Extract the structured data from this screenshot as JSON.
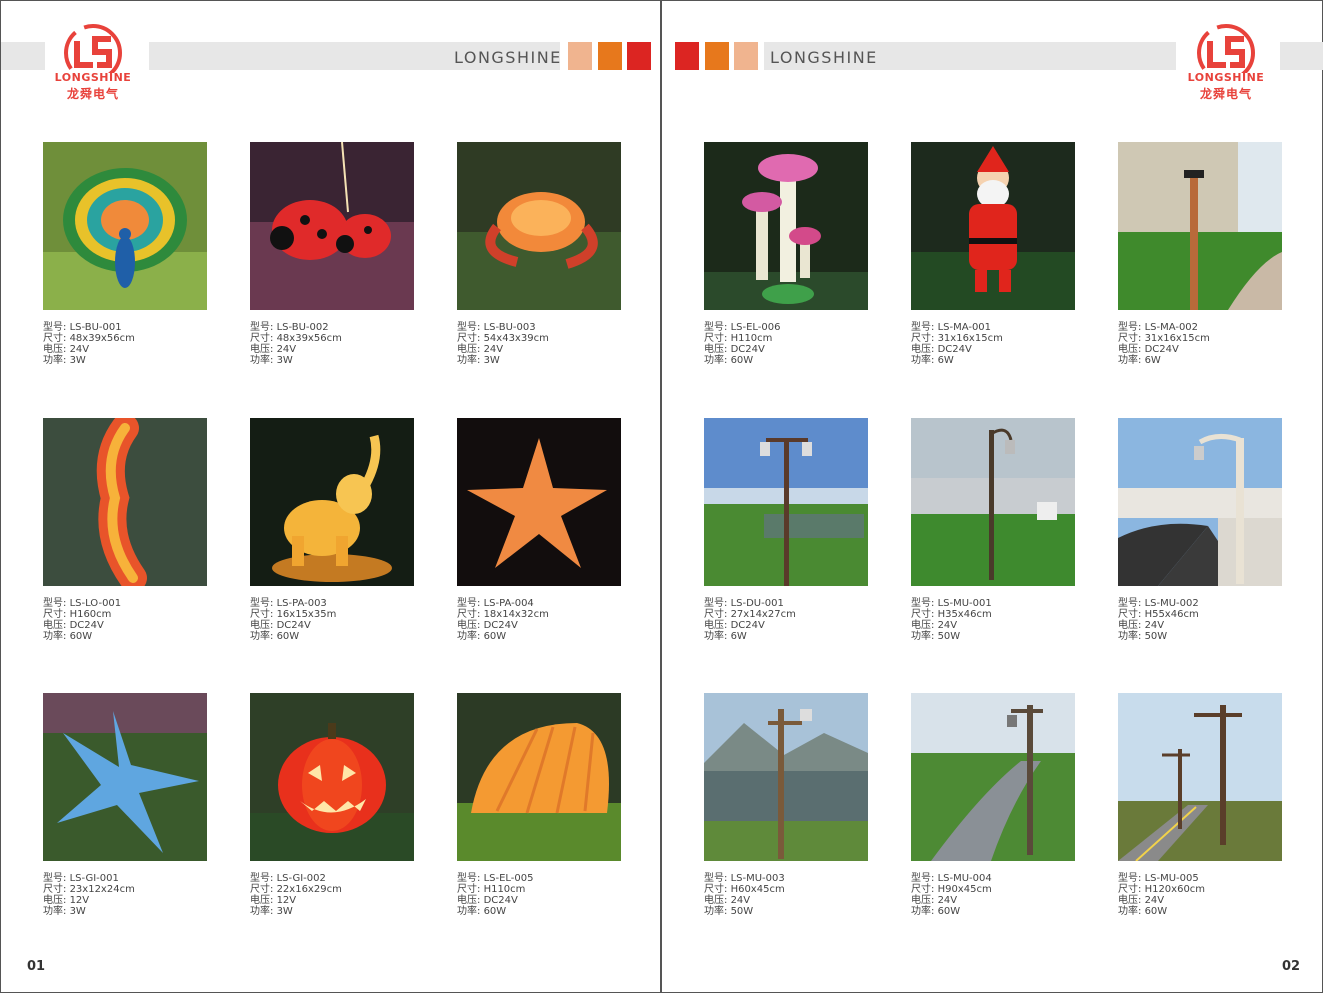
{
  "brand": "LONGSHINE",
  "logo": {
    "en": "LONGSHINE",
    "cn": "龙舜电气"
  },
  "colors": {
    "light": "#f0b48f",
    "orange": "#e7781c",
    "red": "#dc2522",
    "bar": "#e7e7e7"
  },
  "spec_labels": {
    "model": "型号: ",
    "size": "尺寸: ",
    "voltage": "电压: ",
    "power": "功率: "
  },
  "pages": {
    "left": {
      "number": "01",
      "products": [
        {
          "model": "LS-BU-001",
          "size": "48x39x56cm",
          "voltage": "24V",
          "power": "3W",
          "image": "peacock"
        },
        {
          "model": "LS-BU-002",
          "size": "48x39x56cm",
          "voltage": "24V",
          "power": "3W",
          "image": "ladybugs"
        },
        {
          "model": "LS-BU-003",
          "size": "54x43x39cm",
          "voltage": "24V",
          "power": "3W",
          "image": "crab"
        },
        {
          "model": "LS-LO-001",
          "size": "H160cm",
          "voltage": "DC24V",
          "power": "60W",
          "image": "crocodile"
        },
        {
          "model": "LS-PA-003",
          "size": "16x15x35m",
          "voltage": "DC24V",
          "power": "60W",
          "image": "elephant"
        },
        {
          "model": "LS-PA-004",
          "size": "18x14x32cm",
          "voltage": "DC24V",
          "power": "60W",
          "image": "starfish-orange"
        },
        {
          "model": "LS-GI-001",
          "size": "23x12x24cm",
          "voltage": "12V",
          "power": "3W",
          "image": "starfish-blue"
        },
        {
          "model": "LS-GI-002",
          "size": "22x16x29cm",
          "voltage": "12V",
          "power": "3W",
          "image": "pumpkin"
        },
        {
          "model": "LS-EL-005",
          "size": "H110cm",
          "voltage": "DC24V",
          "power": "60W",
          "image": "shell"
        }
      ]
    },
    "right": {
      "number": "02",
      "products": [
        {
          "model": "LS-EL-006",
          "size": "H110cm",
          "voltage": "DC24V",
          "power": "60W",
          "image": "mushrooms"
        },
        {
          "model": "LS-MA-001",
          "size": "31x16x15cm",
          "voltage": "DC24V",
          "power": "6W",
          "image": "santa"
        },
        {
          "model": "LS-MA-002",
          "size": "31x16x15cm",
          "voltage": "DC24V",
          "power": "6W",
          "image": "post-light"
        },
        {
          "model": "LS-DU-001",
          "size": "27x14x27cm",
          "voltage": "DC24V",
          "power": "6W",
          "image": "lamp-double"
        },
        {
          "model": "LS-MU-001",
          "size": "H35x46cm",
          "voltage": "24V",
          "power": "50W",
          "image": "lamp-single"
        },
        {
          "model": "LS-MU-002",
          "size": "H55x46cm",
          "voltage": "24V",
          "power": "50W",
          "image": "lamp-birch"
        },
        {
          "model": "LS-MU-003",
          "size": "H60x45cm",
          "voltage": "24V",
          "power": "50W",
          "image": "lamp-lake"
        },
        {
          "model": "LS-MU-004",
          "size": "H90x45cm",
          "voltage": "24V",
          "power": "60W",
          "image": "lamp-path"
        },
        {
          "model": "LS-MU-005",
          "size": "H120x60cm",
          "voltage": "24V",
          "power": "60W",
          "image": "lamp-road"
        }
      ]
    }
  }
}
